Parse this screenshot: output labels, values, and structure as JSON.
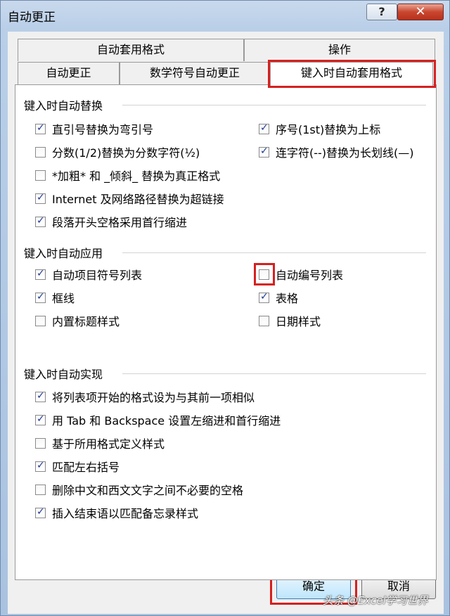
{
  "window": {
    "title": "自动更正",
    "help_label": "?",
    "close_label": "✕"
  },
  "tabs": {
    "row1": [
      {
        "label": "自动套用格式"
      },
      {
        "label": "操作"
      }
    ],
    "row2": [
      {
        "label": "自动更正"
      },
      {
        "label": "数学符号自动更正"
      },
      {
        "label": "键入时自动套用格式",
        "active": true
      }
    ]
  },
  "sections": {
    "replace": {
      "title": "键入时自动替换",
      "items": [
        {
          "label": "直引号替换为弯引号",
          "checked": true
        },
        {
          "label": "序号(1st)替换为上标",
          "checked": true
        },
        {
          "label": "分数(1/2)替换为分数字符(½)",
          "checked": false
        },
        {
          "label": "连字符(--)替换为长划线(—)",
          "checked": true
        },
        {
          "label": "*加粗* 和 _倾斜_ 替换为真正格式",
          "checked": false
        },
        {
          "label": "Internet 及网络路径替换为超链接",
          "checked": true
        },
        {
          "label": "段落开头空格采用首行缩进",
          "checked": true
        }
      ]
    },
    "apply": {
      "title": "键入时自动应用",
      "items": [
        {
          "label": "自动项目符号列表",
          "checked": true
        },
        {
          "label": "自动编号列表",
          "checked": false
        },
        {
          "label": "框线",
          "checked": true
        },
        {
          "label": "表格",
          "checked": true
        },
        {
          "label": "内置标题样式",
          "checked": false
        },
        {
          "label": "日期样式",
          "checked": false
        }
      ]
    },
    "auto": {
      "title": "键入时自动实现",
      "items": [
        {
          "label": "将列表项开始的格式设为与其前一项相似",
          "checked": true
        },
        {
          "label": "用 Tab 和 Backspace 设置左缩进和首行缩进",
          "checked": true
        },
        {
          "label": "基于所用格式定义样式",
          "checked": false
        },
        {
          "label": "匹配左右括号",
          "checked": true
        },
        {
          "label": "删除中文和西文文字之间不必要的空格",
          "checked": false
        },
        {
          "label": "插入结束语以匹配备忘录样式",
          "checked": true
        }
      ]
    }
  },
  "buttons": {
    "ok": "确定",
    "cancel": "取消"
  },
  "watermark": "头条 @Excel学习世界",
  "colors": {
    "highlight": "#d62020",
    "checkmark": "#1f3a93"
  }
}
